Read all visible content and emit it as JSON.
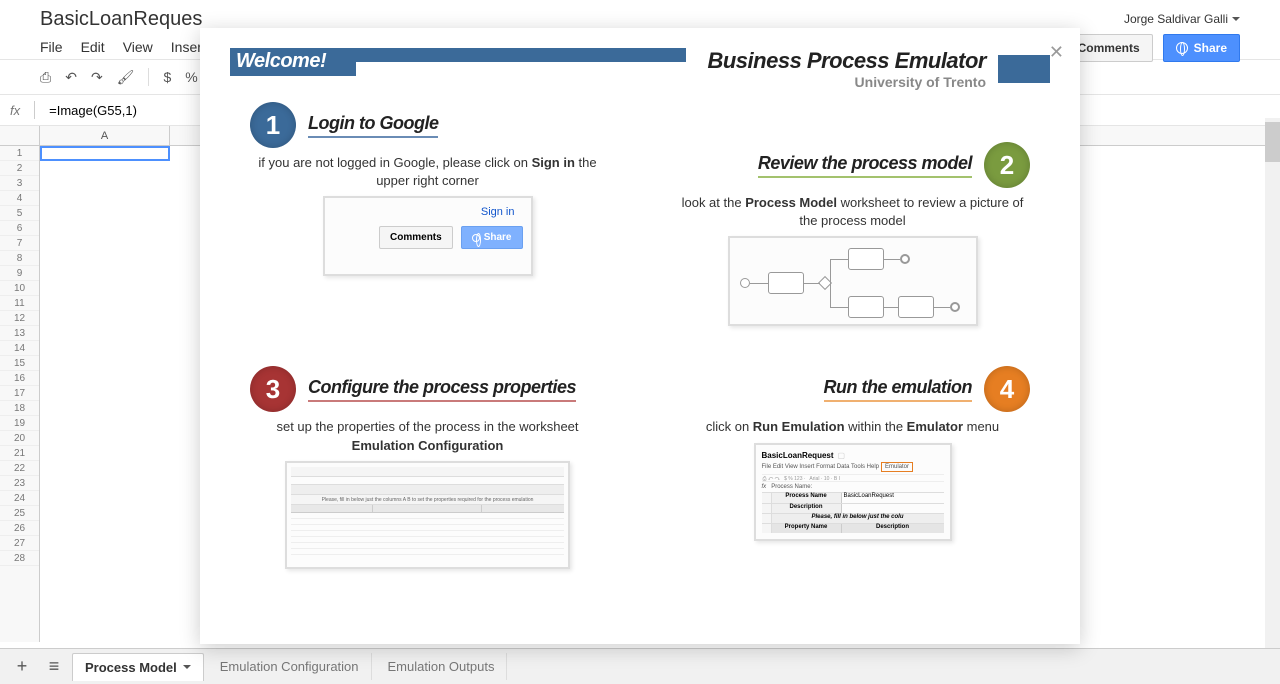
{
  "user": "Jorge Saldivar Galli",
  "docTitle": "BasicLoanReques",
  "menu": [
    "File",
    "Edit",
    "View",
    "Inser"
  ],
  "topButtons": {
    "comments": "Comments",
    "share": "Share"
  },
  "toolbar": {
    "dollar": "$",
    "percent": "%"
  },
  "formula": {
    "fx": "fx",
    "content": "=Image(G55,1)"
  },
  "columns": [
    "A"
  ],
  "rowCount": 28,
  "sheetTabs": {
    "active": "Process Model",
    "t2": "Emulation Configuration",
    "t3": "Emulation Outputs"
  },
  "welcome": "Welcome!",
  "bpe": {
    "title": "Business Process Emulator",
    "subtitle": "University of Trento"
  },
  "step1": {
    "num": "1",
    "title": "Login to Google",
    "desc_pre": "if you are not logged in Google, please click on ",
    "desc_bold": "Sign in",
    "desc_post": " the upper right corner",
    "signin": "Sign in",
    "comments": "Comments",
    "share": "Share"
  },
  "step2": {
    "num": "2",
    "title": "Review the process model",
    "desc_pre": "look at the ",
    "desc_bold": "Process Model",
    "desc_post": " worksheet to review a picture of the process model"
  },
  "step3": {
    "num": "3",
    "title": "Configure the process properties",
    "desc_pre": "set up the properties of the process in the worksheet ",
    "desc_bold": "Emulation Configuration"
  },
  "step4": {
    "num": "4",
    "title": "Run the emulation",
    "desc_pre": "click on ",
    "desc_bold": "Run Emulation",
    "desc_mid": " within the ",
    "desc_bold2": "Emulator",
    "desc_post": " menu",
    "illus_title": "BasicLoanRequest",
    "illus_menu": "File  Edit  View  Insert  Format  Data  Tools  Help",
    "illus_emu": "Emulator",
    "illus_pn": "Process Name:",
    "illus_pn_col": "Process Name",
    "illus_blr": "BasicLoanRequest",
    "illus_desc": "Description",
    "illus_fill": "Please, fill in below just the colu",
    "illus_prop": "Property Name",
    "illus_desc2": "Description"
  }
}
